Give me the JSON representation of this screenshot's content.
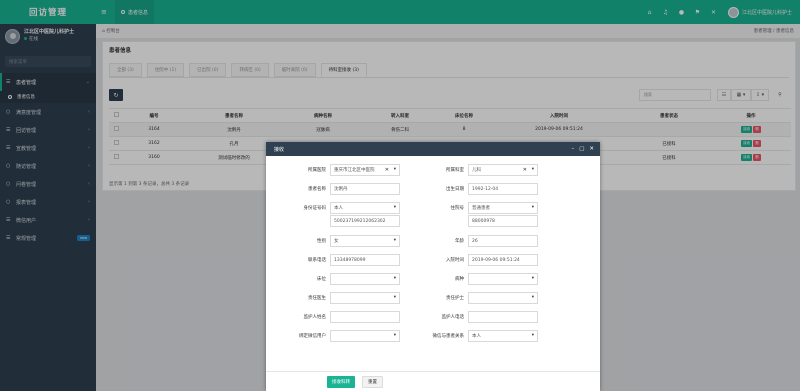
{
  "app": {
    "title": "回访管理"
  },
  "profile": {
    "name": "江北区中医院儿科护士",
    "status": "在线"
  },
  "sidebar": {
    "search_placeholder": "搜索菜单",
    "items": [
      {
        "label": "患者管理",
        "icon": "list-icon"
      },
      {
        "label": "满意度管理",
        "icon": "circle-icon"
      },
      {
        "label": "回访管理",
        "icon": "list-icon"
      },
      {
        "label": "宣教管理",
        "icon": "list-icon"
      },
      {
        "label": "随访管理",
        "icon": "circle-icon"
      },
      {
        "label": "问卷管理",
        "icon": "circle-icon"
      },
      {
        "label": "报表管理",
        "icon": "circle-icon"
      },
      {
        "label": "微信用户",
        "icon": "list-icon"
      },
      {
        "label": "常规管理",
        "icon": "list-icon",
        "badge": "new"
      }
    ],
    "sub_item": "患者信息"
  },
  "topbar": {
    "tab": "患者信息",
    "user": "江北区中医院儿科护士"
  },
  "breadcrumb": {
    "home": "控制台",
    "path": "患者管理 / 患者信息"
  },
  "panel": {
    "title": "患者信息",
    "tabs": [
      "全部 (3)",
      "住院中 (1)",
      "已出院 (0)",
      "转病区 (0)",
      "临时离院 (0)",
      "待科室接收 (3)"
    ],
    "search_placeholder": "搜索",
    "columns": [
      "编号",
      "患者名称",
      "病种名称",
      "转入科室",
      "床位名称",
      "入院时间",
      "患者状态",
      "操作"
    ],
    "rows": [
      {
        "id": "3164",
        "name": "沈俐丹",
        "disease": "冠脉病",
        "dept": "骨伤二科",
        "bed": "8",
        "time": "2019-09-06 09:51:24",
        "status": ""
      },
      {
        "id": "3162",
        "name": "孔月",
        "disease": "",
        "dept": "",
        "bed": "",
        "time": "",
        "status": "已接科"
      },
      {
        "id": "3160",
        "name": "测试临时修改的",
        "disease": "",
        "dept": "",
        "bed": "",
        "time": "",
        "status": "已接科"
      }
    ],
    "action_receive": "接收",
    "action_delete": "删",
    "pager": "显示第 1 到第 3 条记录，总共 3 条记录"
  },
  "modal": {
    "title": "接收",
    "fields": {
      "hospital_label": "所属医院",
      "hospital_value": "重庆市江北区中医院",
      "dept_label": "所属科室",
      "dept_value": "儿科",
      "name_label": "患者名称",
      "name_value": "沈俐丹",
      "birth_label": "出生日期",
      "birth_value": "1992-12-04",
      "idtype_label": "身份证号码",
      "idtype_value": "本人",
      "id_value": "500237199212062302",
      "insure_label": "住院号",
      "insure_type": "普通患者",
      "insure_value": "88000978",
      "gender_label": "性别",
      "gender_value": "女",
      "age_label": "年龄",
      "age_value": "26",
      "phone_label": "联系电话",
      "phone_value": "13348978099",
      "admit_label": "入院时间",
      "admit_value": "2019-09-06 09:51:24",
      "bed_label": "床位",
      "bed_value": "",
      "disease_label": "病种",
      "disease_value": "",
      "doctor_label": "责任医生",
      "doctor_value": "",
      "nurse_label": "责任护士",
      "nurse_value": "",
      "guardian_label": "监护人姓名",
      "guardian_value": "",
      "guardian_phone_label": "监护人电话",
      "guardian_phone_value": "",
      "wechat_label": "绑定微信用户",
      "wechat_value": "",
      "relation_label": "微信与患者关系",
      "relation_value": "本人"
    },
    "save_label": "接收科转",
    "reset_label": "重置"
  }
}
